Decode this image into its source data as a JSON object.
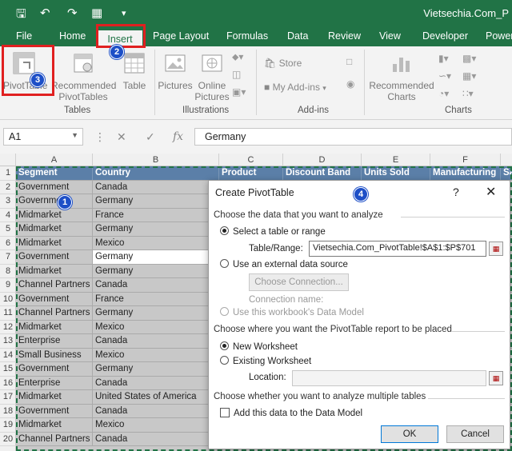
{
  "window": {
    "title": "Vietsechia.Com_P"
  },
  "ribbon_tabs": [
    "File",
    "Home",
    "Insert",
    "Page Layout",
    "Formulas",
    "Data",
    "Review",
    "View",
    "Developer",
    "Power"
  ],
  "ribbon": {
    "tables": {
      "pivottable": "PivotTable",
      "recommended_pivottables_1": "Recommended",
      "recommended_pivottables_2": "PivotTables",
      "table": "Table",
      "group": "Tables"
    },
    "illustrations": {
      "pictures": "Pictures",
      "online_pictures_1": "Online",
      "online_pictures_2": "Pictures",
      "group": "Illustrations"
    },
    "addins": {
      "store": "Store",
      "my_addins": "My Add-ins",
      "group": "Add-ins"
    },
    "charts": {
      "recommended_charts_1": "Recommended",
      "recommended_charts_2": "Charts",
      "group": "Charts"
    }
  },
  "formula_bar": {
    "name_box": "A1",
    "fx": "fx",
    "value": "Germany"
  },
  "columns": [
    "A",
    "B",
    "C",
    "D",
    "E",
    "F"
  ],
  "rows": [
    [
      "Segment",
      "Country",
      "Product",
      "Discount Band",
      "Units Sold",
      "Manufacturing",
      "Sa"
    ],
    [
      "Government",
      "Canada"
    ],
    [
      "Government",
      "Germany"
    ],
    [
      "Midmarket",
      "France"
    ],
    [
      "Midmarket",
      "Germany"
    ],
    [
      "Midmarket",
      "Mexico"
    ],
    [
      "Government",
      "Germany"
    ],
    [
      "Midmarket",
      "Germany"
    ],
    [
      "Channel Partners",
      "Canada"
    ],
    [
      "Government",
      "France"
    ],
    [
      "Channel Partners",
      "Germany"
    ],
    [
      "Midmarket",
      "Mexico"
    ],
    [
      "Enterprise",
      "Canada"
    ],
    [
      "Small Business",
      "Mexico"
    ],
    [
      "Government",
      "Germany"
    ],
    [
      "Enterprise",
      "Canada"
    ],
    [
      "Midmarket",
      "United States of America"
    ],
    [
      "Government",
      "Canada"
    ],
    [
      "Midmarket",
      "Mexico"
    ],
    [
      "Channel Partners",
      "Canada"
    ]
  ],
  "dialog": {
    "title": "Create PivotTable",
    "help": "?",
    "close": "✕",
    "section1": "Choose the data that you want to analyze",
    "opt_select_range": "Select a table or range",
    "table_range_label": "Table/Range:",
    "table_range_value": "Vietsechia.Com_PivotTable!$A$1:$P$701",
    "opt_external": "Use an external data source",
    "choose_connection": "Choose Connection...",
    "connection_name_label": "Connection name:",
    "opt_data_model": "Use this workbook's Data Model",
    "section2": "Choose where you want the PivotTable report to be placed",
    "opt_new_ws": "New Worksheet",
    "opt_existing_ws": "Existing Worksheet",
    "location_label": "Location:",
    "section3": "Choose whether you want to analyze multiple tables",
    "add_data_model": "Add this data to the Data Model",
    "ok": "OK",
    "cancel": "Cancel"
  },
  "callouts": [
    "1",
    "2",
    "3",
    "4"
  ],
  "colors": {
    "excel_green": "#217346",
    "callout_red": "#e02020",
    "callout_blue": "#1d4fc7",
    "header_fill": "#5b7fa8"
  }
}
